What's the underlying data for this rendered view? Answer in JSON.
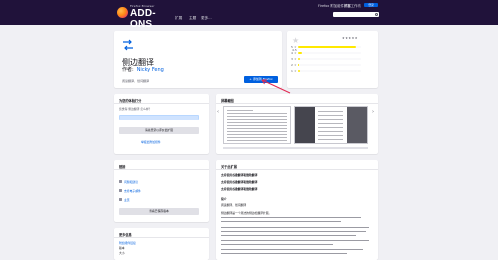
{
  "header": {
    "brand_small": "Firefox Browser",
    "brand_big": "ADD-ONS",
    "top_link_1": "Firefox 附加组件博客",
    "top_link_2": "扩展工作坊",
    "top_button": "登录",
    "nav": [
      "扩展",
      "主题",
      "更多…"
    ]
  },
  "addon": {
    "name": "侧边翻译",
    "author_label": "作者:",
    "author_name": "Nicky Feng",
    "summary": "阅读翻译、划词翻译",
    "install_label": "添加到 Firefox"
  },
  "ratings": {
    "big_star": "★",
    "score_text": "4.5",
    "star_scale": "★★★★★",
    "rows": [
      {
        "num": "5",
        "fill": 0.92,
        "count": ""
      },
      {
        "num": "4",
        "fill": 0.07,
        "count": ""
      },
      {
        "num": "3",
        "fill": 0.03,
        "count": ""
      },
      {
        "num": "2",
        "fill": 0.01,
        "count": ""
      },
      {
        "num": "1",
        "fill": 0.03,
        "count": ""
      }
    ]
  },
  "rate": {
    "title": "为您的体验打分",
    "prompt": "您觉得 侧边翻译 怎么样？",
    "login_btn": "请先登录以评价此扩展",
    "report_link": "举报此附加组件"
  },
  "screenshots": {
    "title": "屏幕截图"
  },
  "links": {
    "title": "链接",
    "items": [
      "问题和建议",
      "支持电子邮件",
      "主页"
    ],
    "button": "查看已保存版本"
  },
  "more": {
    "title": "更多信息",
    "items": [
      "附加组件链接",
      "版本",
      "大小"
    ]
  },
  "about": {
    "title": "关于此扩展",
    "line1": "支持使用谷歌翻译和微软翻译",
    "line2": "支持使用谷歌翻译和微软翻译",
    "line3": "支持使用谷歌翻译和微软翻译",
    "line4": "简介",
    "line5": "阅读翻译、划词翻译",
    "line6": "侧边翻译是一个简洁的侧边栏翻译扩展。"
  },
  "colors": {
    "header_bg": "#20123a",
    "accent": "#0060df",
    "page_bg": "#f0f0f4",
    "rating_bar": "#ffe900",
    "annotation": "#e22850"
  }
}
